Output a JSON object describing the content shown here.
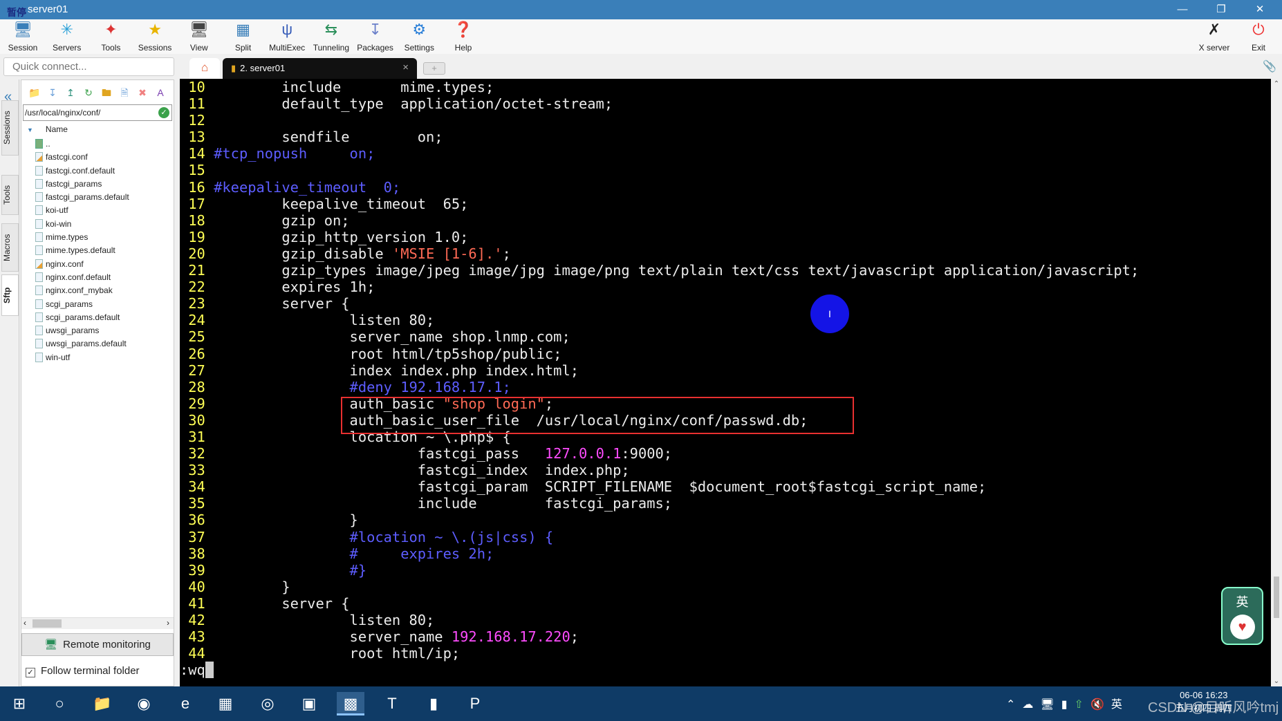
{
  "window": {
    "title": "server01",
    "overlay_label": "暂停"
  },
  "toolbar": {
    "items": [
      {
        "label": "Session",
        "icon": "session-icon"
      },
      {
        "label": "Servers",
        "icon": "servers-icon"
      },
      {
        "label": "Tools",
        "icon": "tools-icon"
      },
      {
        "label": "Sessions",
        "icon": "star-icon"
      },
      {
        "label": "View",
        "icon": "view-icon"
      },
      {
        "label": "Split",
        "icon": "split-icon"
      },
      {
        "label": "MultiExec",
        "icon": "multiexec-icon"
      },
      {
        "label": "Tunneling",
        "icon": "tunneling-icon"
      },
      {
        "label": "Packages",
        "icon": "packages-icon"
      },
      {
        "label": "Settings",
        "icon": "gear-icon"
      },
      {
        "label": "Help",
        "icon": "help-icon"
      }
    ],
    "xserver": "X server",
    "exit": "Exit"
  },
  "quick_connect": {
    "placeholder": "Quick connect..."
  },
  "side_tabs": [
    "Sessions",
    "Tools",
    "Macros",
    "Sftp"
  ],
  "sftp": {
    "path": "/usr/local/nginx/conf/",
    "column": "Name",
    "parent": "..",
    "files": [
      {
        "name": "fastcgi.conf",
        "edited": true
      },
      {
        "name": "fastcgi.conf.default"
      },
      {
        "name": "fastcgi_params"
      },
      {
        "name": "fastcgi_params.default"
      },
      {
        "name": "koi-utf"
      },
      {
        "name": "koi-win"
      },
      {
        "name": "mime.types"
      },
      {
        "name": "mime.types.default"
      },
      {
        "name": "nginx.conf",
        "edited": true
      },
      {
        "name": "nginx.conf.default"
      },
      {
        "name": "nginx.conf_mybak"
      },
      {
        "name": "scgi_params"
      },
      {
        "name": "scgi_params.default"
      },
      {
        "name": "uwsgi_params"
      },
      {
        "name": "uwsgi_params.default"
      },
      {
        "name": "win-utf"
      }
    ],
    "remote_monitoring": "Remote monitoring",
    "follow_terminal": {
      "label": "Follow terminal folder",
      "checked": true
    }
  },
  "tabs": [
    {
      "label": "2. server01",
      "active": true
    }
  ],
  "terminal": {
    "colors": {
      "line_number": "#ffff55",
      "comment": "#5d5dff",
      "string": "#ff6a55",
      "number": "#ff4cff",
      "text": "#ececec"
    },
    "lines": [
      {
        "n": "10",
        "segs": [
          [
            "        include       mime.types;",
            ""
          ]
        ]
      },
      {
        "n": "11",
        "segs": [
          [
            "        default_type  application/octet-stream;",
            ""
          ]
        ]
      },
      {
        "n": "12",
        "segs": [
          [
            "",
            ""
          ]
        ]
      },
      {
        "n": "13",
        "segs": [
          [
            "        sendfile        on;",
            ""
          ]
        ]
      },
      {
        "n": "14",
        "segs": [
          [
            "#tcp_nopush     on;",
            "cmt"
          ]
        ]
      },
      {
        "n": "15",
        "segs": [
          [
            "",
            ""
          ]
        ]
      },
      {
        "n": "16",
        "segs": [
          [
            "#keepalive_timeout  0;",
            "cmt"
          ]
        ]
      },
      {
        "n": "17",
        "segs": [
          [
            "        keepalive_timeout  65;",
            ""
          ]
        ]
      },
      {
        "n": "18",
        "segs": [
          [
            "        gzip on;",
            ""
          ]
        ]
      },
      {
        "n": "19",
        "segs": [
          [
            "        gzip_http_version 1.0;",
            ""
          ]
        ]
      },
      {
        "n": "20",
        "segs": [
          [
            "        gzip_disable ",
            ""
          ],
          [
            "'MSIE [1-6].'",
            "str"
          ],
          [
            ";",
            ""
          ]
        ]
      },
      {
        "n": "21",
        "segs": [
          [
            "        gzip_types image/jpeg image/jpg image/png text/plain text/css text/javascript application/javascript;",
            ""
          ]
        ]
      },
      {
        "n": "22",
        "segs": [
          [
            "        expires 1h;",
            ""
          ]
        ]
      },
      {
        "n": "23",
        "segs": [
          [
            "        server {",
            ""
          ]
        ]
      },
      {
        "n": "24",
        "segs": [
          [
            "                listen 80;",
            ""
          ]
        ]
      },
      {
        "n": "25",
        "segs": [
          [
            "                server_name shop.lnmp.com;",
            ""
          ]
        ]
      },
      {
        "n": "26",
        "segs": [
          [
            "                root html/tp5shop/public;",
            ""
          ]
        ]
      },
      {
        "n": "27",
        "segs": [
          [
            "                index index.php index.html;",
            ""
          ]
        ]
      },
      {
        "n": "28",
        "segs": [
          [
            "                ",
            ""
          ],
          [
            "#deny 192.168.17.1;",
            "cmt"
          ]
        ]
      },
      {
        "n": "29",
        "segs": [
          [
            "                auth_basic ",
            ""
          ],
          [
            "\"shop login\"",
            "str"
          ],
          [
            ";",
            ""
          ]
        ]
      },
      {
        "n": "30",
        "segs": [
          [
            "                auth_basic_user_file  /usr/local/nginx/conf/passwd.db;",
            ""
          ]
        ]
      },
      {
        "n": "31",
        "segs": [
          [
            "                location ~ \\.php$ {",
            ""
          ]
        ]
      },
      {
        "n": "32",
        "segs": [
          [
            "                        fastcgi_pass   ",
            ""
          ],
          [
            "127.0.0.1",
            "mag"
          ],
          [
            ":9000;",
            ""
          ]
        ]
      },
      {
        "n": "33",
        "segs": [
          [
            "                        fastcgi_index  index.php;",
            ""
          ]
        ]
      },
      {
        "n": "34",
        "segs": [
          [
            "                        fastcgi_param  SCRIPT_FILENAME  $document_root$fastcgi_script_name;",
            ""
          ]
        ]
      },
      {
        "n": "35",
        "segs": [
          [
            "                        include        fastcgi_params;",
            ""
          ]
        ]
      },
      {
        "n": "36",
        "segs": [
          [
            "                }",
            ""
          ]
        ]
      },
      {
        "n": "37",
        "segs": [
          [
            "                ",
            ""
          ],
          [
            "#location ~ \\.(js|css) {",
            "cmt"
          ]
        ]
      },
      {
        "n": "38",
        "segs": [
          [
            "                ",
            ""
          ],
          [
            "#     expires 2h;",
            "cmt"
          ]
        ]
      },
      {
        "n": "39",
        "segs": [
          [
            "                ",
            ""
          ],
          [
            "#}",
            "cmt"
          ]
        ]
      },
      {
        "n": "40",
        "segs": [
          [
            "        }",
            ""
          ]
        ]
      },
      {
        "n": "41",
        "segs": [
          [
            "        server {",
            ""
          ]
        ]
      },
      {
        "n": "42",
        "segs": [
          [
            "                listen 80;",
            ""
          ]
        ]
      },
      {
        "n": "43",
        "segs": [
          [
            "                server_name ",
            ""
          ],
          [
            "192.168.17.220",
            "mag"
          ],
          [
            ";",
            ""
          ]
        ]
      },
      {
        "n": "44",
        "segs": [
          [
            "                root html/ip;",
            ""
          ]
        ]
      }
    ],
    "command": ":wq",
    "highlight_box_color": "#e83030"
  },
  "widget": {
    "label": "英"
  },
  "taskbar": {
    "apps": [
      "start-icon",
      "search-icon",
      "file-explorer-icon",
      "color-app-icon",
      "edge-icon",
      "spreadsheet-icon",
      "chrome-icon",
      "remote-desktop-icon",
      "mobaxterm-icon",
      "typora-icon",
      "terminal-icon",
      "pdf-icon"
    ],
    "tray": {
      "ime": "英",
      "clock_time": "06-06 16:23",
      "clock_date": "五月初四 周四",
      "watermark": "CSDN @目听风吟tmj"
    }
  }
}
